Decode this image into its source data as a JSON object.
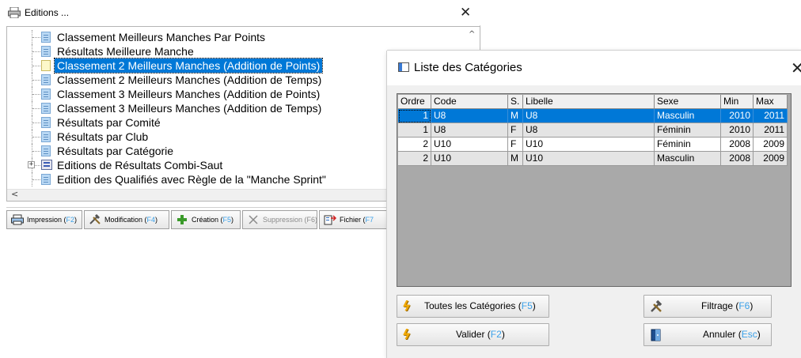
{
  "editions": {
    "title": "Editions ...",
    "close": "✕",
    "tree_items": [
      {
        "label": "Classement Meilleurs Manches Par Points"
      },
      {
        "label": "Résultats Meilleure Manche"
      },
      {
        "label": "Classement 2 Meilleurs Manches (Addition de Points)"
      },
      {
        "label": "Classement 2 Meilleurs Manches (Addition de Temps)"
      },
      {
        "label": "Classement 3 Meilleurs Manches (Addition de Points)"
      },
      {
        "label": "Classement 3 Meilleurs Manches (Addition de Temps)"
      },
      {
        "label": "Résultats par Comité"
      },
      {
        "label": "Résultats par Club"
      },
      {
        "label": "Résultats par Catégorie"
      },
      {
        "label": "Editions de Résultats Combi-Saut"
      },
      {
        "label": "Edition des Qualifiés avec Règle de la \"Manche Sprint\""
      }
    ],
    "selected_index": 2,
    "expand_symbol": "+",
    "scroll_up": "^",
    "scroll_left": "<",
    "toolbar": {
      "impression": {
        "label": "Impression (",
        "key": "F2",
        "close": ")"
      },
      "modification": {
        "label": "Modification (",
        "key": "F4",
        "close": ")"
      },
      "creation": {
        "label": "Création (",
        "key": "F5",
        "close": ")"
      },
      "suppression": {
        "label": "Suppression (F6)"
      },
      "fichier": {
        "label": "Fichier (",
        "key": "F7"
      }
    }
  },
  "categories": {
    "title": "Liste des Catégories",
    "close": "✕",
    "columns": [
      "Ordre",
      "Code",
      "S.",
      "Libelle",
      "Sexe",
      "Min",
      "Max"
    ],
    "rows": [
      {
        "ordre": "1",
        "code": "U8",
        "s": "M",
        "libelle": "U8",
        "sexe": "Masculin",
        "min": "2010",
        "max": "2011"
      },
      {
        "ordre": "1",
        "code": "U8",
        "s": "F",
        "libelle": "U8",
        "sexe": "Féminin",
        "min": "2010",
        "max": "2011"
      },
      {
        "ordre": "2",
        "code": "U10",
        "s": "F",
        "libelle": "U10",
        "sexe": "Féminin",
        "min": "2008",
        "max": "2009"
      },
      {
        "ordre": "2",
        "code": "U10",
        "s": "M",
        "libelle": "U10",
        "sexe": "Masculin",
        "min": "2008",
        "max": "2009"
      }
    ],
    "selected_row": 0,
    "buttons": {
      "toutes": {
        "label": "Toutes les Catégories (",
        "key": "F5",
        "close": ")"
      },
      "filtrage": {
        "label": "Filtrage (",
        "key": "F6",
        "close": ")"
      },
      "valider": {
        "label": "Valider (",
        "key": "F2",
        "close": ")"
      },
      "annuler": {
        "label": "Annuler (",
        "key": "Esc",
        "close": ")"
      }
    }
  },
  "colors": {
    "selection": "#0078d7",
    "function_key": "#3aa0e8",
    "grid_background": "#a9a9a9"
  }
}
